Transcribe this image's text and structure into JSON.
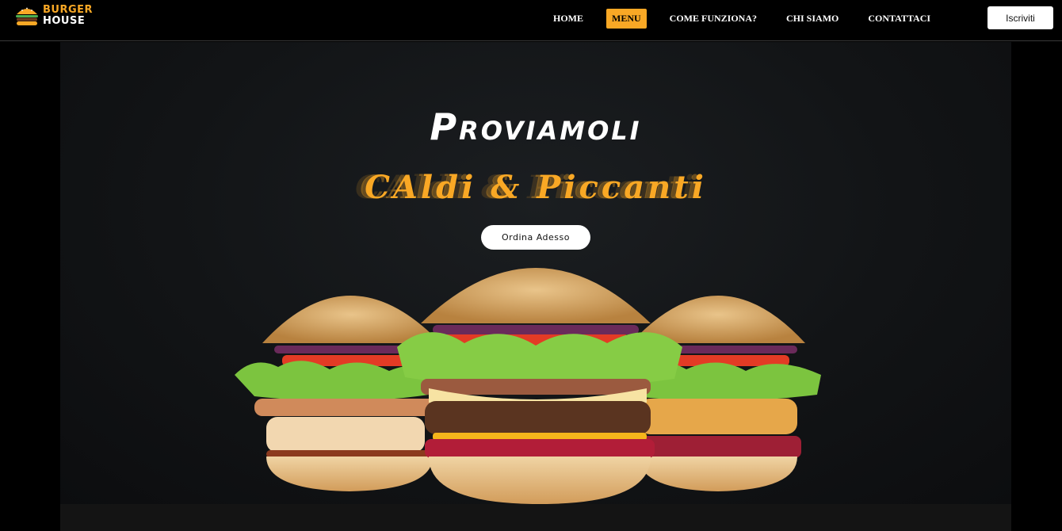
{
  "brand": {
    "line1": "BURGER",
    "line2": "HOUSE",
    "icon": "burger-logo-icon",
    "accent": "#f9a825"
  },
  "nav": {
    "items": [
      {
        "label": "Home",
        "active": false
      },
      {
        "label": "Menu",
        "active": true
      },
      {
        "label": "Come funziona?",
        "active": false
      },
      {
        "label": "Chi siamo",
        "active": false
      },
      {
        "label": "Contattaci",
        "active": false
      }
    ],
    "signup_label": "Iscriviti"
  },
  "hero": {
    "title": "Proviamoli",
    "subtitle": "CAldi & Piccanti",
    "cta_label": "Ordina Adesso",
    "image": "three-burgers-image"
  },
  "colors": {
    "background": "#000000",
    "accent": "#f9a825",
    "hero_bg": "#141618"
  }
}
